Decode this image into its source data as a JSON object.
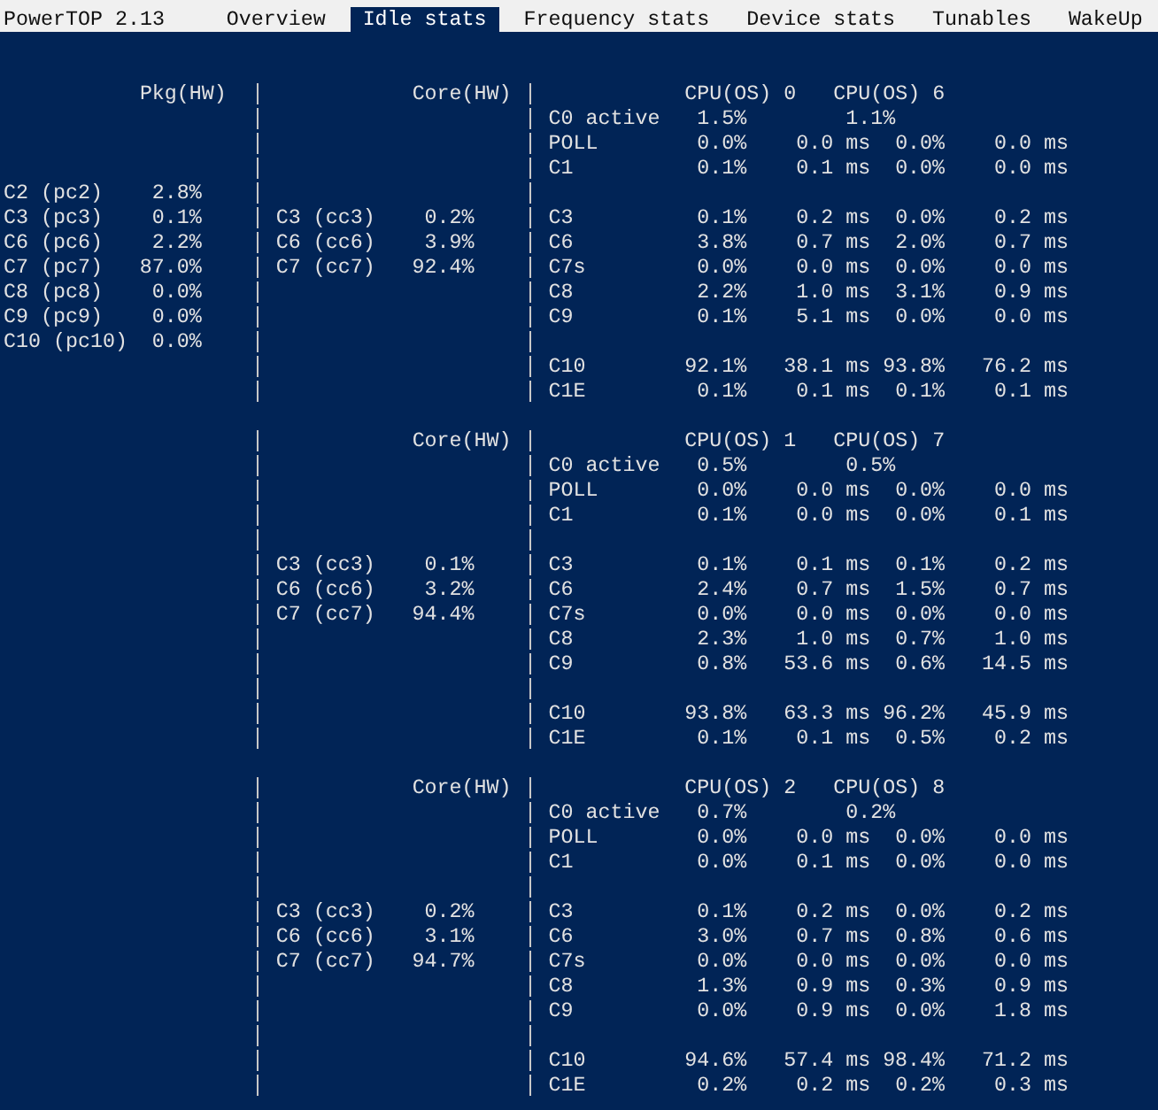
{
  "header": {
    "title": "PowerTOP 2.13"
  },
  "tabs": [
    {
      "label": "Overview",
      "selected": false
    },
    {
      "label": "Idle stats",
      "selected": true
    },
    {
      "label": "Frequency stats",
      "selected": false
    },
    {
      "label": "Device stats",
      "selected": false
    },
    {
      "label": "Tunables",
      "selected": false
    },
    {
      "label": "WakeUp",
      "selected": false
    }
  ],
  "blocks": [
    {
      "package": {
        "heading": "Pkg(HW)",
        "states": [
          {
            "name": "C2 (pc2)",
            "residency": "2.8%"
          },
          {
            "name": "C3 (pc3)",
            "residency": "0.1%"
          },
          {
            "name": "C6 (pc6)",
            "residency": "2.2%"
          },
          {
            "name": "C7 (pc7)",
            "residency": "87.0%"
          },
          {
            "name": "C8 (pc8)",
            "residency": "0.0%"
          },
          {
            "name": "C9 (pc9)",
            "residency": "0.0%"
          },
          {
            "name": "C10 (pc10)",
            "residency": "0.0%"
          }
        ]
      },
      "core": {
        "heading": "Core(HW)",
        "states": [
          {
            "name": "C3 (cc3)",
            "residency": "0.2%"
          },
          {
            "name": "C6 (cc6)",
            "residency": "3.9%"
          },
          {
            "name": "C7 (cc7)",
            "residency": "92.4%"
          }
        ]
      },
      "cpus": {
        "headings": [
          "CPU(OS) 0",
          "CPU(OS) 6"
        ],
        "groups": [
          [
            {
              "name": "C0 active",
              "cpus": [
                {
                  "residency": "1.5%"
                },
                {
                  "residency": "1.1%"
                }
              ]
            },
            {
              "name": "POLL",
              "cpus": [
                {
                  "residency": "0.0%",
                  "time": "0.0 ms"
                },
                {
                  "residency": "0.0%",
                  "time": "0.0 ms"
                }
              ]
            },
            {
              "name": "C1",
              "cpus": [
                {
                  "residency": "0.1%",
                  "time": "0.1 ms"
                },
                {
                  "residency": "0.0%",
                  "time": "0.0 ms"
                }
              ]
            }
          ],
          [
            {
              "name": "C3",
              "cpus": [
                {
                  "residency": "0.1%",
                  "time": "0.2 ms"
                },
                {
                  "residency": "0.0%",
                  "time": "0.2 ms"
                }
              ]
            },
            {
              "name": "C6",
              "cpus": [
                {
                  "residency": "3.8%",
                  "time": "0.7 ms"
                },
                {
                  "residency": "2.0%",
                  "time": "0.7 ms"
                }
              ]
            },
            {
              "name": "C7s",
              "cpus": [
                {
                  "residency": "0.0%",
                  "time": "0.0 ms"
                },
                {
                  "residency": "0.0%",
                  "time": "0.0 ms"
                }
              ]
            },
            {
              "name": "C8",
              "cpus": [
                {
                  "residency": "2.2%",
                  "time": "1.0 ms"
                },
                {
                  "residency": "3.1%",
                  "time": "0.9 ms"
                }
              ]
            },
            {
              "name": "C9",
              "cpus": [
                {
                  "residency": "0.1%",
                  "time": "5.1 ms"
                },
                {
                  "residency": "0.0%",
                  "time": "0.0 ms"
                }
              ]
            }
          ],
          [
            {
              "name": "C10",
              "cpus": [
                {
                  "residency": "92.1%",
                  "time": "38.1 ms"
                },
                {
                  "residency": "93.8%",
                  "time": "76.2 ms"
                }
              ]
            },
            {
              "name": "C1E",
              "cpus": [
                {
                  "residency": "0.1%",
                  "time": "0.1 ms"
                },
                {
                  "residency": "0.1%",
                  "time": "0.1 ms"
                }
              ]
            }
          ]
        ]
      }
    },
    {
      "core": {
        "heading": "Core(HW)",
        "states": [
          {
            "name": "C3 (cc3)",
            "residency": "0.1%"
          },
          {
            "name": "C6 (cc6)",
            "residency": "3.2%"
          },
          {
            "name": "C7 (cc7)",
            "residency": "94.4%"
          }
        ]
      },
      "cpus": {
        "headings": [
          "CPU(OS) 1",
          "CPU(OS) 7"
        ],
        "groups": [
          [
            {
              "name": "C0 active",
              "cpus": [
                {
                  "residency": "0.5%"
                },
                {
                  "residency": "0.5%"
                }
              ]
            },
            {
              "name": "POLL",
              "cpus": [
                {
                  "residency": "0.0%",
                  "time": "0.0 ms"
                },
                {
                  "residency": "0.0%",
                  "time": "0.0 ms"
                }
              ]
            },
            {
              "name": "C1",
              "cpus": [
                {
                  "residency": "0.1%",
                  "time": "0.0 ms"
                },
                {
                  "residency": "0.0%",
                  "time": "0.1 ms"
                }
              ]
            }
          ],
          [
            {
              "name": "C3",
              "cpus": [
                {
                  "residency": "0.1%",
                  "time": "0.1 ms"
                },
                {
                  "residency": "0.1%",
                  "time": "0.2 ms"
                }
              ]
            },
            {
              "name": "C6",
              "cpus": [
                {
                  "residency": "2.4%",
                  "time": "0.7 ms"
                },
                {
                  "residency": "1.5%",
                  "time": "0.7 ms"
                }
              ]
            },
            {
              "name": "C7s",
              "cpus": [
                {
                  "residency": "0.0%",
                  "time": "0.0 ms"
                },
                {
                  "residency": "0.0%",
                  "time": "0.0 ms"
                }
              ]
            },
            {
              "name": "C8",
              "cpus": [
                {
                  "residency": "2.3%",
                  "time": "1.0 ms"
                },
                {
                  "residency": "0.7%",
                  "time": "1.0 ms"
                }
              ]
            },
            {
              "name": "C9",
              "cpus": [
                {
                  "residency": "0.8%",
                  "time": "53.6 ms"
                },
                {
                  "residency": "0.6%",
                  "time": "14.5 ms"
                }
              ]
            }
          ],
          [
            {
              "name": "C10",
              "cpus": [
                {
                  "residency": "93.8%",
                  "time": "63.3 ms"
                },
                {
                  "residency": "96.2%",
                  "time": "45.9 ms"
                }
              ]
            },
            {
              "name": "C1E",
              "cpus": [
                {
                  "residency": "0.1%",
                  "time": "0.1 ms"
                },
                {
                  "residency": "0.5%",
                  "time": "0.2 ms"
                }
              ]
            }
          ]
        ]
      }
    },
    {
      "core": {
        "heading": "Core(HW)",
        "states": [
          {
            "name": "C3 (cc3)",
            "residency": "0.2%"
          },
          {
            "name": "C6 (cc6)",
            "residency": "3.1%"
          },
          {
            "name": "C7 (cc7)",
            "residency": "94.7%"
          }
        ]
      },
      "cpus": {
        "headings": [
          "CPU(OS) 2",
          "CPU(OS) 8"
        ],
        "groups": [
          [
            {
              "name": "C0 active",
              "cpus": [
                {
                  "residency": "0.7%"
                },
                {
                  "residency": "0.2%"
                }
              ]
            },
            {
              "name": "POLL",
              "cpus": [
                {
                  "residency": "0.0%",
                  "time": "0.0 ms"
                },
                {
                  "residency": "0.0%",
                  "time": "0.0 ms"
                }
              ]
            },
            {
              "name": "C1",
              "cpus": [
                {
                  "residency": "0.0%",
                  "time": "0.1 ms"
                },
                {
                  "residency": "0.0%",
                  "time": "0.0 ms"
                }
              ]
            }
          ],
          [
            {
              "name": "C3",
              "cpus": [
                {
                  "residency": "0.1%",
                  "time": "0.2 ms"
                },
                {
                  "residency": "0.0%",
                  "time": "0.2 ms"
                }
              ]
            },
            {
              "name": "C6",
              "cpus": [
                {
                  "residency": "3.0%",
                  "time": "0.7 ms"
                },
                {
                  "residency": "0.8%",
                  "time": "0.6 ms"
                }
              ]
            },
            {
              "name": "C7s",
              "cpus": [
                {
                  "residency": "0.0%",
                  "time": "0.0 ms"
                },
                {
                  "residency": "0.0%",
                  "time": "0.0 ms"
                }
              ]
            },
            {
              "name": "C8",
              "cpus": [
                {
                  "residency": "1.3%",
                  "time": "0.9 ms"
                },
                {
                  "residency": "0.3%",
                  "time": "0.9 ms"
                }
              ]
            },
            {
              "name": "C9",
              "cpus": [
                {
                  "residency": "0.0%",
                  "time": "0.9 ms"
                },
                {
                  "residency": "0.0%",
                  "time": "1.8 ms"
                }
              ]
            }
          ],
          [
            {
              "name": "C10",
              "cpus": [
                {
                  "residency": "94.6%",
                  "time": "57.4 ms"
                },
                {
                  "residency": "98.4%",
                  "time": "71.2 ms"
                }
              ]
            },
            {
              "name": "C1E",
              "cpus": [
                {
                  "residency": "0.2%",
                  "time": "0.2 ms"
                },
                {
                  "residency": "0.2%",
                  "time": "0.3 ms"
                }
              ]
            }
          ]
        ]
      }
    }
  ]
}
